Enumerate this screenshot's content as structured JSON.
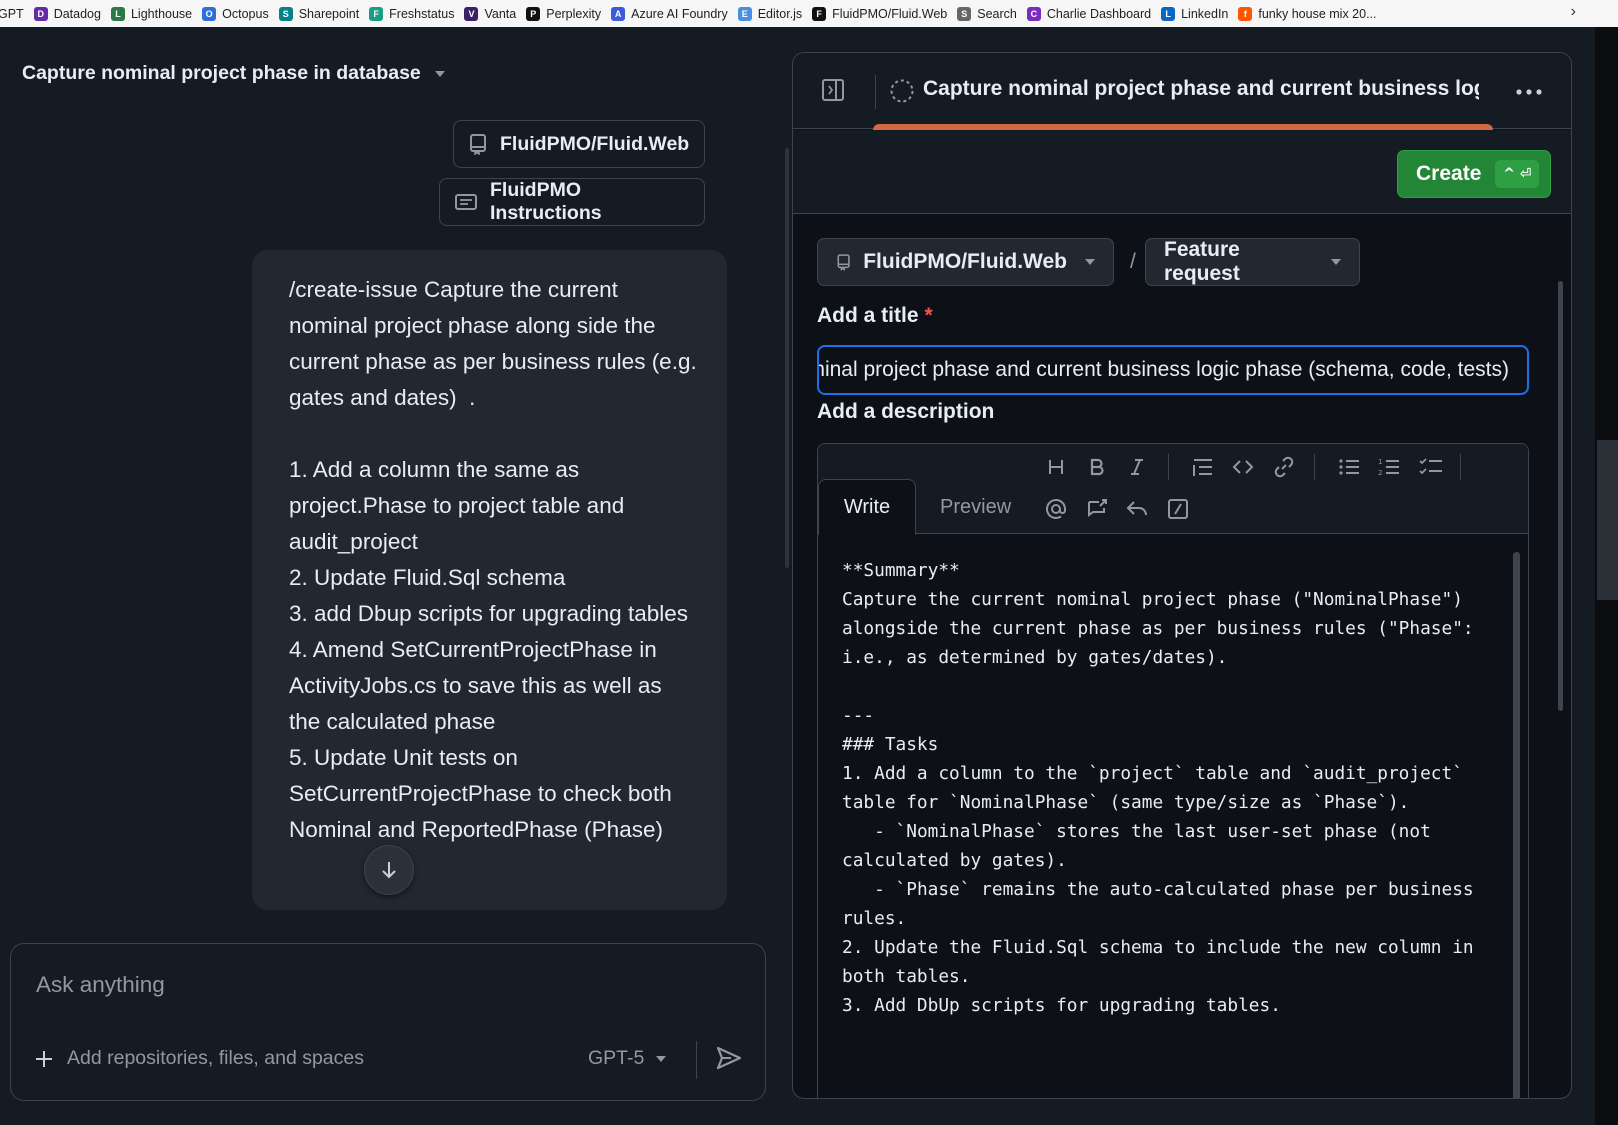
{
  "bookmarks": [
    {
      "label": "GPT",
      "color": "#444444"
    },
    {
      "label": "Datadog",
      "color": "#632ca6"
    },
    {
      "label": "Lighthouse",
      "color": "#2a7a46"
    },
    {
      "label": "Octopus",
      "color": "#2f6fdb"
    },
    {
      "label": "Sharepoint",
      "color": "#038387"
    },
    {
      "label": "Freshstatus",
      "color": "#1b9c85"
    },
    {
      "label": "Vanta",
      "color": "#3a1f6b"
    },
    {
      "label": "Perplexity",
      "color": "#111111"
    },
    {
      "label": "Azure AI Foundry",
      "color": "#3b5bdb"
    },
    {
      "label": "Editor.js",
      "color": "#4a90e2"
    },
    {
      "label": "FluidPMO/Fluid.Web",
      "color": "#111111"
    },
    {
      "label": "Search",
      "color": "#666666"
    },
    {
      "label": "Charlie Dashboard",
      "color": "#7b2cbf"
    },
    {
      "label": "LinkedIn",
      "color": "#0a66c2"
    },
    {
      "label": "funky house mix 20...",
      "color": "#ff5500"
    }
  ],
  "chat": {
    "title": "Capture nominal project phase in database",
    "repo_chip": "FluidPMO/Fluid.Web",
    "instructions_chip": "FluidPMO Instructions",
    "message": "/create-issue Capture the current nominal project phase along side the current phase as per business rules (e.g. gates and dates)  .\n\n1. Add a column the same as project.Phase to project table and audit_project\n2. Update Fluid.Sql schema\n3. add Dbup scripts for upgrading tables\n4. Amend SetCurrentProjectPhase in ActivityJobs.cs to save this as well as the calculated phase\n5. Update Unit tests on SetCurrentProjectPhase to check both Nominal and ReportedPhase (Phase)",
    "composer_placeholder": "Ask anything",
    "add_context": "Add repositories, files, and spaces",
    "model": "GPT-5"
  },
  "issue": {
    "header_title": "Capture nominal project phase and current business logic phase (schema, code, tests)",
    "create_label": "Create",
    "create_shortcut": "^ ⏎",
    "repo": "FluidPMO/Fluid.Web",
    "separator": "/",
    "template": "Feature request",
    "title_label": "Add a title",
    "required_mark": "*",
    "title_value": "Capture nominal project phase and current business logic phase (schema, code, tests)",
    "description_label": "Add a description",
    "tab_write": "Write",
    "tab_preview": "Preview",
    "toolbar_icons": [
      "heading-icon",
      "bold-icon",
      "italic-icon",
      "quote-icon",
      "code-icon",
      "link-icon",
      "bullet-list-icon",
      "numbered-list-icon",
      "task-list-icon",
      "mention-icon",
      "reference-icon",
      "reply-icon",
      "slash-command-icon"
    ],
    "description": "**Summary**\nCapture the current nominal project phase (\"NominalPhase\") alongside the current phase as per business rules (\"Phase\": i.e., as determined by gates/dates).\n\n---\n### Tasks\n1. Add a column to the `project` table and `audit_project` table for `NominalPhase` (same type/size as `Phase`).\n   - `NominalPhase` stores the last user-set phase (not calculated by gates).\n   - `Phase` remains the auto-calculated phase per business rules.\n2. Update the Fluid.Sql schema to include the new column in both tables.\n3. Add DbUp scripts for upgrading tables."
  },
  "colors": {
    "background": "#0d1117",
    "surface": "#151b23",
    "accent_blue": "#1f6feb",
    "create_green": "#238636",
    "progress_orange": "#d2693f"
  }
}
